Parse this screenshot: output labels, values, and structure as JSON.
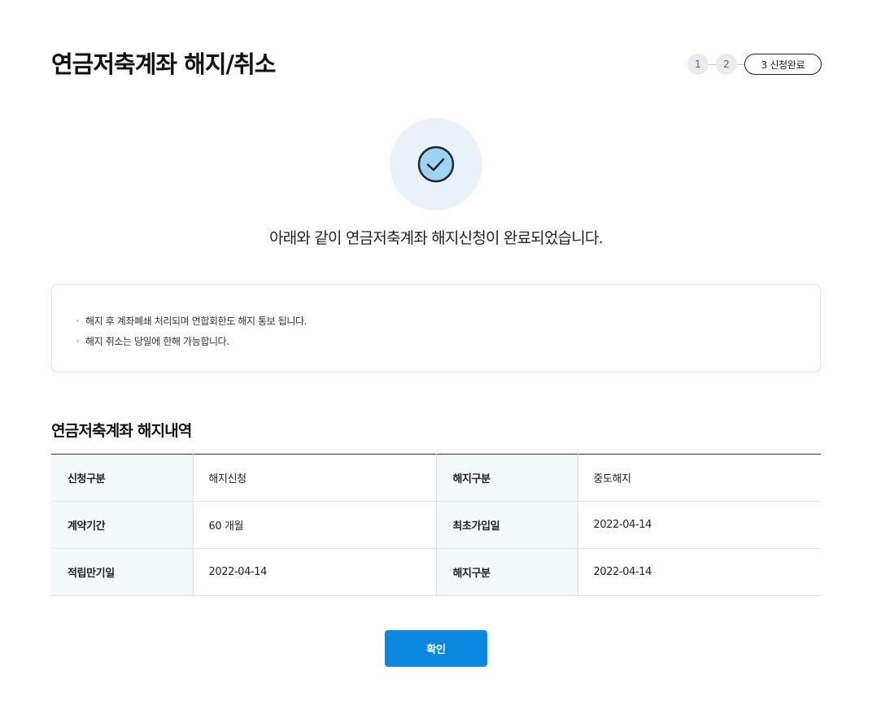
{
  "page": {
    "title": "연금저축계좌 해지/취소"
  },
  "stepper": {
    "steps": [
      {
        "label": "1",
        "state": "inactive"
      },
      {
        "label": "2",
        "state": "inactive"
      },
      {
        "label": "3 신청완료",
        "state": "active"
      }
    ]
  },
  "status": {
    "icon": "check-circle-icon",
    "message": "아래와 같이 연금저축계좌 해지신청이 완료되었습니다."
  },
  "notice": {
    "items": [
      "해지 후 계좌폐쇄 처리되며 연합회한도 해지 통보 됩니다.",
      "해지 취소는 당일에 한해 가능합니다."
    ]
  },
  "details": {
    "title": "연금저축계좌 해지내역",
    "rows": [
      {
        "label1": "신청구분",
        "value1": "해지신청",
        "label2": "해지구분",
        "value2": "중도해지"
      },
      {
        "label1": "계약기간",
        "value1": "60 개월",
        "label2": "최초가입일",
        "value2": "2022-04-14"
      },
      {
        "label1": "적립만기일",
        "value1": "2022-04-14",
        "label2": "해지구분",
        "value2": "2022-04-14"
      }
    ]
  },
  "actions": {
    "confirm_label": "확인"
  },
  "colors": {
    "primary": "#0a88e0",
    "icon_fill": "#9ed3f1",
    "icon_bg": "#eaf1f8",
    "table_header_bg": "#f3f8fb"
  }
}
